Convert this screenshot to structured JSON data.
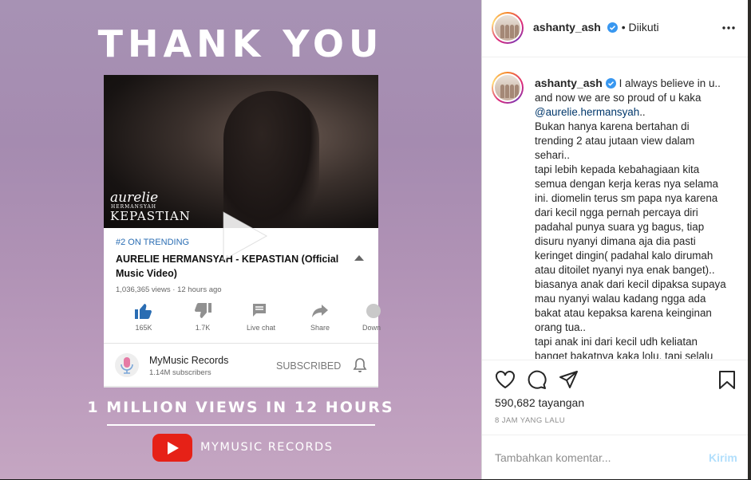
{
  "media": {
    "thank_you": "THANK YOU",
    "video": {
      "brand_script": "aurelie",
      "brand_small": "HERMANSYAH",
      "brand_title": "KEPASTIAN",
      "trending": "#2 ON TRENDING",
      "title": "AURELIE HERMANSYAH - KEPASTIAN (Official Music Video)",
      "meta": "1,036,365 views · 12 hours ago",
      "actions": [
        {
          "label": "165K",
          "icon": "thumbs-up-icon"
        },
        {
          "label": "1.7K",
          "icon": "thumbs-down-icon"
        },
        {
          "label": "Live chat",
          "icon": "chat-icon"
        },
        {
          "label": "Share",
          "icon": "share-icon"
        },
        {
          "label": "Down",
          "icon": "download-icon"
        }
      ],
      "channel": {
        "name": "MyMusic Records",
        "subs": "1.14M subscribers",
        "status": "SUBSCRIBED"
      }
    },
    "million_views": "1 MILLION VIEWS IN 12 HOURS",
    "footer_label": "MYMUSIC RECORDS",
    "colors": {
      "youtube_red": "#e62117",
      "like_blue": "#2a6db3"
    }
  },
  "post": {
    "username": "ashanty_ash",
    "follow_status": "• Diikuti",
    "caption_user": "ashanty_ash",
    "caption": {
      "p1": "I always believe in u.. and now we are so proud of u kaka ",
      "mention": "@aurelie.hermansyah",
      "p2": "..",
      "body": "Bukan hanya karena bertahan di trending 2 atau jutaan view dalam sehari..\ntapi lebih kepada kebahagiaan kita semua dengan kerja keras nya selama ini. diomelin terus sm papa nya karena dari kecil ngga pernah percaya diri padahal punya suara yg bagus, tiap disuru nyanyi dimana aja dia pasti keringet dingin( padahal kalo dirumah atau ditoilet nyanyi nya enak banget)..\nbiasanya anak dari kecil dipaksa supaya mau nyanyi walau kadang ngga ada bakat atau kepaksa karena keinginan orang tua..\ntapi anak ini dari kecil udh keliatan banget bakatnya kaka lolu, tapi selalu"
    },
    "views": "590,682 tayangan",
    "time": "8 JAM YANG LALU",
    "comment_placeholder": "Tambahkan komentar...",
    "send_label": "Kirim"
  }
}
